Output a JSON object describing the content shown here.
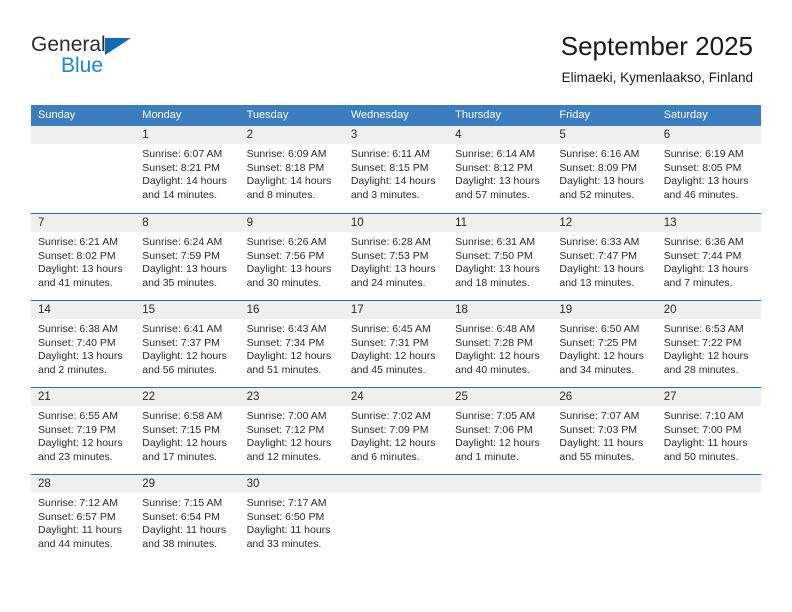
{
  "brand": {
    "name_part1": "General",
    "name_part2": "Blue",
    "triangle_icon": "triangle-icon",
    "accent_color": "#1668b3",
    "secondary_color": "#1f86d8"
  },
  "header": {
    "title": "September 2025",
    "subtitle": "Elimaeki, Kymenlaakso, Finland"
  },
  "calendar": {
    "header_bg": "#3b7dbf",
    "daynum_bg": "#efefef",
    "weekday_headers": [
      "Sunday",
      "Monday",
      "Tuesday",
      "Wednesday",
      "Thursday",
      "Friday",
      "Saturday"
    ],
    "weeks": [
      [
        {
          "day": "",
          "line1": "",
          "line2": "",
          "line3": "",
          "line4": ""
        },
        {
          "day": "1",
          "line1": "Sunrise: 6:07 AM",
          "line2": "Sunset: 8:21 PM",
          "line3": "Daylight: 14 hours",
          "line4": "and 14 minutes."
        },
        {
          "day": "2",
          "line1": "Sunrise: 6:09 AM",
          "line2": "Sunset: 8:18 PM",
          "line3": "Daylight: 14 hours",
          "line4": "and 8 minutes."
        },
        {
          "day": "3",
          "line1": "Sunrise: 6:11 AM",
          "line2": "Sunset: 8:15 PM",
          "line3": "Daylight: 14 hours",
          "line4": "and 3 minutes."
        },
        {
          "day": "4",
          "line1": "Sunrise: 6:14 AM",
          "line2": "Sunset: 8:12 PM",
          "line3": "Daylight: 13 hours",
          "line4": "and 57 minutes."
        },
        {
          "day": "5",
          "line1": "Sunrise: 6:16 AM",
          "line2": "Sunset: 8:09 PM",
          "line3": "Daylight: 13 hours",
          "line4": "and 52 minutes."
        },
        {
          "day": "6",
          "line1": "Sunrise: 6:19 AM",
          "line2": "Sunset: 8:05 PM",
          "line3": "Daylight: 13 hours",
          "line4": "and 46 minutes."
        }
      ],
      [
        {
          "day": "7",
          "line1": "Sunrise: 6:21 AM",
          "line2": "Sunset: 8:02 PM",
          "line3": "Daylight: 13 hours",
          "line4": "and 41 minutes."
        },
        {
          "day": "8",
          "line1": "Sunrise: 6:24 AM",
          "line2": "Sunset: 7:59 PM",
          "line3": "Daylight: 13 hours",
          "line4": "and 35 minutes."
        },
        {
          "day": "9",
          "line1": "Sunrise: 6:26 AM",
          "line2": "Sunset: 7:56 PM",
          "line3": "Daylight: 13 hours",
          "line4": "and 30 minutes."
        },
        {
          "day": "10",
          "line1": "Sunrise: 6:28 AM",
          "line2": "Sunset: 7:53 PM",
          "line3": "Daylight: 13 hours",
          "line4": "and 24 minutes."
        },
        {
          "day": "11",
          "line1": "Sunrise: 6:31 AM",
          "line2": "Sunset: 7:50 PM",
          "line3": "Daylight: 13 hours",
          "line4": "and 18 minutes."
        },
        {
          "day": "12",
          "line1": "Sunrise: 6:33 AM",
          "line2": "Sunset: 7:47 PM",
          "line3": "Daylight: 13 hours",
          "line4": "and 13 minutes."
        },
        {
          "day": "13",
          "line1": "Sunrise: 6:36 AM",
          "line2": "Sunset: 7:44 PM",
          "line3": "Daylight: 13 hours",
          "line4": "and 7 minutes."
        }
      ],
      [
        {
          "day": "14",
          "line1": "Sunrise: 6:38 AM",
          "line2": "Sunset: 7:40 PM",
          "line3": "Daylight: 13 hours",
          "line4": "and 2 minutes."
        },
        {
          "day": "15",
          "line1": "Sunrise: 6:41 AM",
          "line2": "Sunset: 7:37 PM",
          "line3": "Daylight: 12 hours",
          "line4": "and 56 minutes."
        },
        {
          "day": "16",
          "line1": "Sunrise: 6:43 AM",
          "line2": "Sunset: 7:34 PM",
          "line3": "Daylight: 12 hours",
          "line4": "and 51 minutes."
        },
        {
          "day": "17",
          "line1": "Sunrise: 6:45 AM",
          "line2": "Sunset: 7:31 PM",
          "line3": "Daylight: 12 hours",
          "line4": "and 45 minutes."
        },
        {
          "day": "18",
          "line1": "Sunrise: 6:48 AM",
          "line2": "Sunset: 7:28 PM",
          "line3": "Daylight: 12 hours",
          "line4": "and 40 minutes."
        },
        {
          "day": "19",
          "line1": "Sunrise: 6:50 AM",
          "line2": "Sunset: 7:25 PM",
          "line3": "Daylight: 12 hours",
          "line4": "and 34 minutes."
        },
        {
          "day": "20",
          "line1": "Sunrise: 6:53 AM",
          "line2": "Sunset: 7:22 PM",
          "line3": "Daylight: 12 hours",
          "line4": "and 28 minutes."
        }
      ],
      [
        {
          "day": "21",
          "line1": "Sunrise: 6:55 AM",
          "line2": "Sunset: 7:19 PM",
          "line3": "Daylight: 12 hours",
          "line4": "and 23 minutes."
        },
        {
          "day": "22",
          "line1": "Sunrise: 6:58 AM",
          "line2": "Sunset: 7:15 PM",
          "line3": "Daylight: 12 hours",
          "line4": "and 17 minutes."
        },
        {
          "day": "23",
          "line1": "Sunrise: 7:00 AM",
          "line2": "Sunset: 7:12 PM",
          "line3": "Daylight: 12 hours",
          "line4": "and 12 minutes."
        },
        {
          "day": "24",
          "line1": "Sunrise: 7:02 AM",
          "line2": "Sunset: 7:09 PM",
          "line3": "Daylight: 12 hours",
          "line4": "and 6 minutes."
        },
        {
          "day": "25",
          "line1": "Sunrise: 7:05 AM",
          "line2": "Sunset: 7:06 PM",
          "line3": "Daylight: 12 hours",
          "line4": "and 1 minute."
        },
        {
          "day": "26",
          "line1": "Sunrise: 7:07 AM",
          "line2": "Sunset: 7:03 PM",
          "line3": "Daylight: 11 hours",
          "line4": "and 55 minutes."
        },
        {
          "day": "27",
          "line1": "Sunrise: 7:10 AM",
          "line2": "Sunset: 7:00 PM",
          "line3": "Daylight: 11 hours",
          "line4": "and 50 minutes."
        }
      ],
      [
        {
          "day": "28",
          "line1": "Sunrise: 7:12 AM",
          "line2": "Sunset: 6:57 PM",
          "line3": "Daylight: 11 hours",
          "line4": "and 44 minutes."
        },
        {
          "day": "29",
          "line1": "Sunrise: 7:15 AM",
          "line2": "Sunset: 6:54 PM",
          "line3": "Daylight: 11 hours",
          "line4": "and 38 minutes."
        },
        {
          "day": "30",
          "line1": "Sunrise: 7:17 AM",
          "line2": "Sunset: 6:50 PM",
          "line3": "Daylight: 11 hours",
          "line4": "and 33 minutes."
        },
        {
          "day": "",
          "line1": "",
          "line2": "",
          "line3": "",
          "line4": ""
        },
        {
          "day": "",
          "line1": "",
          "line2": "",
          "line3": "",
          "line4": ""
        },
        {
          "day": "",
          "line1": "",
          "line2": "",
          "line3": "",
          "line4": ""
        },
        {
          "day": "",
          "line1": "",
          "line2": "",
          "line3": "",
          "line4": ""
        }
      ]
    ]
  }
}
